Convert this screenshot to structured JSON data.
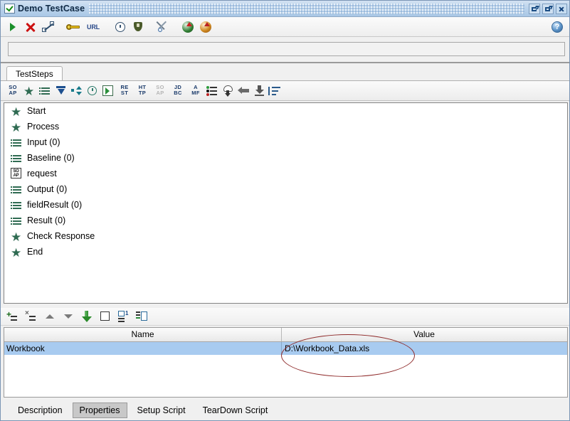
{
  "window": {
    "title": "Demo TestCase",
    "app_icon": "testcase-checkbox-icon",
    "controls": {
      "minimize": "minimize",
      "maximize": "maximize",
      "close": "close"
    }
  },
  "main_toolbar": {
    "items": [
      {
        "name": "run-testcase",
        "icon": "play-run-icon",
        "label": ""
      },
      {
        "name": "cancel-testcase",
        "icon": "cancel-x-icon",
        "label": ""
      },
      {
        "name": "testcase-options",
        "icon": "options-icon",
        "label": ""
      },
      {
        "name": "security-test",
        "icon": "key-icon",
        "label": ""
      },
      {
        "name": "url-button",
        "icon": "url-text-icon",
        "label": "URL"
      },
      {
        "name": "loadtest",
        "icon": "clock-icon",
        "label": ""
      },
      {
        "name": "security-scan",
        "icon": "shield-icon",
        "label": ""
      },
      {
        "name": "tools",
        "icon": "tools-icon",
        "label": ""
      },
      {
        "name": "transfer-previous",
        "icon": "green-circle-arrow-icon",
        "label": ""
      },
      {
        "name": "transfer-next",
        "icon": "orange-circle-arrow-icon",
        "label": ""
      }
    ],
    "help": {
      "name": "help-button",
      "icon": "help-question-icon",
      "label": "?"
    }
  },
  "progress": {
    "value": "",
    "placeholder": ""
  },
  "main_tabs": [
    {
      "label": "TestSteps",
      "active": true
    }
  ],
  "steps_toolbar": [
    {
      "name": "add-soap-request-step",
      "icon": "soap-icon",
      "label": "SO\nAP",
      "text_label": "SOAP",
      "dim": false
    },
    {
      "name": "add-groovy-script-step",
      "icon": "star-icon",
      "label": "",
      "dim": false
    },
    {
      "name": "add-properties-step",
      "icon": "list-icon",
      "label": "",
      "dim": false
    },
    {
      "name": "add-property-transfer-step",
      "icon": "down-arrow-icon",
      "label": "",
      "dim": false
    },
    {
      "name": "add-conditional-goto-step",
      "icon": "updown-arrow-icon",
      "label": "",
      "dim": false
    },
    {
      "name": "add-delay-step",
      "icon": "clock-icon",
      "label": "",
      "dim": false
    },
    {
      "name": "add-run-testcase-step",
      "icon": "boxed-arrow-icon",
      "label": "",
      "dim": false
    },
    {
      "name": "add-rest-request-step",
      "icon": "rest-icon",
      "text_label": "REST",
      "dim": false
    },
    {
      "name": "add-http-request-step",
      "icon": "http-icon",
      "text_label": "HTTP",
      "dim": false
    },
    {
      "name": "add-soap-mock-step",
      "icon": "soap-dim-icon",
      "text_label": "SOAP",
      "dim": true
    },
    {
      "name": "add-jdbc-request-step",
      "icon": "jdbc-icon",
      "text_label": "JDBC",
      "dim": false
    },
    {
      "name": "add-amf-request-step",
      "icon": "amf-icon",
      "text_label": "AMF",
      "dim": false
    },
    {
      "name": "add-datasource-step",
      "icon": "bullets-icon",
      "label": "",
      "dim": false
    },
    {
      "name": "add-datasink-step",
      "icon": "hierarchy-icon",
      "label": "",
      "dim": false
    },
    {
      "name": "add-datasource-loop-step",
      "icon": "left-arrow-icon",
      "label": "",
      "dim": false
    },
    {
      "name": "add-datagen-step",
      "icon": "down-bar-arrow-icon",
      "label": "",
      "dim": false
    },
    {
      "name": "add-manual-step",
      "icon": "sort-lines-icon",
      "label": "",
      "dim": false
    }
  ],
  "test_steps": [
    {
      "label": "Start",
      "icon": "star-icon"
    },
    {
      "label": "Process",
      "icon": "star-icon"
    },
    {
      "label": "Input (0)",
      "icon": "list-icon"
    },
    {
      "label": "Baseline (0)",
      "icon": "list-icon"
    },
    {
      "label": "request",
      "icon": "soap-icon"
    },
    {
      "label": "Output (0)",
      "icon": "list-icon"
    },
    {
      "label": "fieldResult (0)",
      "icon": "list-icon"
    },
    {
      "label": "Result (0)",
      "icon": "list-icon"
    },
    {
      "label": "Check Response",
      "icon": "star-icon"
    },
    {
      "label": "End",
      "icon": "star-icon"
    }
  ],
  "properties_toolbar": [
    {
      "name": "add-property-button",
      "icon": "add-row-icon"
    },
    {
      "name": "remove-property-button",
      "icon": "remove-row-icon"
    },
    {
      "name": "move-property-up-button",
      "icon": "caret-up-icon"
    },
    {
      "name": "move-property-down-button",
      "icon": "caret-down-icon"
    },
    {
      "name": "load-properties-button",
      "icon": "green-down-arrow-icon"
    },
    {
      "name": "clear-properties-button",
      "icon": "square-icon"
    },
    {
      "name": "save-properties-button",
      "icon": "list-one-icon"
    },
    {
      "name": "import-properties-button",
      "icon": "list-import-icon"
    }
  ],
  "properties_table": {
    "columns": [
      "Name",
      "Value"
    ],
    "rows": [
      {
        "name": "Workbook",
        "value": "D:\\Workbook_Data.xls",
        "selected": true
      }
    ]
  },
  "annotation": {
    "shape": "ellipse",
    "color": "#8f2b2b",
    "targets": "D:\\Workbook_Data.xls"
  },
  "bottom_tabs": [
    {
      "label": "Description",
      "active": false
    },
    {
      "label": "Properties",
      "active": true
    },
    {
      "label": "Setup Script",
      "active": false
    },
    {
      "label": "TearDown Script",
      "active": false
    }
  ]
}
